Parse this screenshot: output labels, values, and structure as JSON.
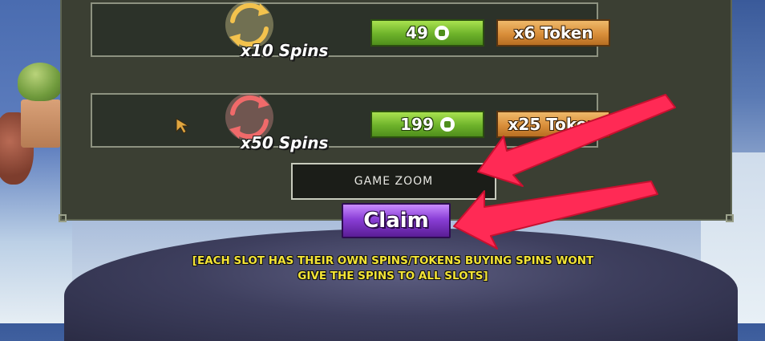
{
  "colors": {
    "panel_bg": "#3b3f33",
    "price_green": "#6db22a",
    "token_orange": "#d98e3a",
    "claim_purple": "#8a3fd6",
    "notice_yellow": "#f3e436",
    "arrow_red": "#ff2a55",
    "spin10_icon": "#f3c24d",
    "spin50_icon": "#f06a6a"
  },
  "offers": [
    {
      "spins_label": "x10 Spins",
      "price": "49",
      "price_icon": "robux-icon",
      "token_label": "x6 Token"
    },
    {
      "spins_label": "x50 Spins",
      "price": "199",
      "price_icon": "robux-icon",
      "token_label": "x25 Token"
    }
  ],
  "game_zoom_label": "GAME ZOOM",
  "claim_label": "Claim",
  "notice": {
    "line1": "[EACH SLOT HAS THEIR OWN SPINS/TOKENS BUYING SPINS WONT",
    "line2": "GIVE THE SPINS TO ALL SLOTS]"
  }
}
